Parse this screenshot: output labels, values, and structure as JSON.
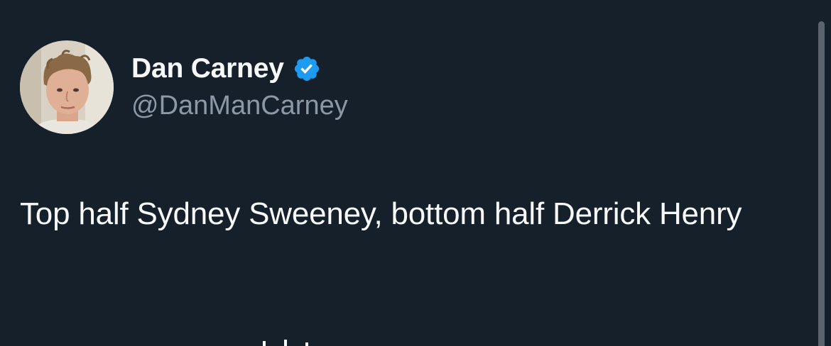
{
  "user": {
    "display_name": "Dan Carney",
    "handle": "@DanManCarney",
    "verified": true,
    "avatar_icon": "profile-photo"
  },
  "tweet": {
    "text": "Top half Sydney Sweeney, bottom half Derrick Henry"
  },
  "colors": {
    "background": "#15202b",
    "primary_text": "#f7f9f9",
    "secondary_text": "#8b98a5",
    "verified_badge": "#1d9bf0",
    "scrollbar": "#5b646d"
  }
}
